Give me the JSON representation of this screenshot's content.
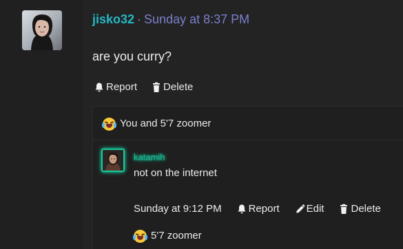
{
  "post": {
    "username": "jisko32",
    "separator": "·",
    "timestamp": "Sunday at 8:37 PM",
    "message": "are you curry?",
    "actions": {
      "report": "Report",
      "delete": "Delete"
    },
    "avatar_icon": "profile-photo",
    "username_color": "#25b8c4",
    "timestamp_color": "#7b80cc"
  },
  "reply_section": {
    "likes_text": "You and 5'7 zoomer",
    "likes_emoji": "laughing-crying-emoji"
  },
  "comment": {
    "username": "katamih",
    "text": "not on the internet",
    "timestamp": "Sunday at 9:12 PM",
    "actions": {
      "report": "Report",
      "edit": "Edit",
      "delete": "Delete"
    },
    "likes_text": "5'7 zoomer",
    "likes_emoji": "laughing-crying-emoji",
    "avatar_icon": "profile-photo",
    "glow_color": "#17c79b"
  }
}
